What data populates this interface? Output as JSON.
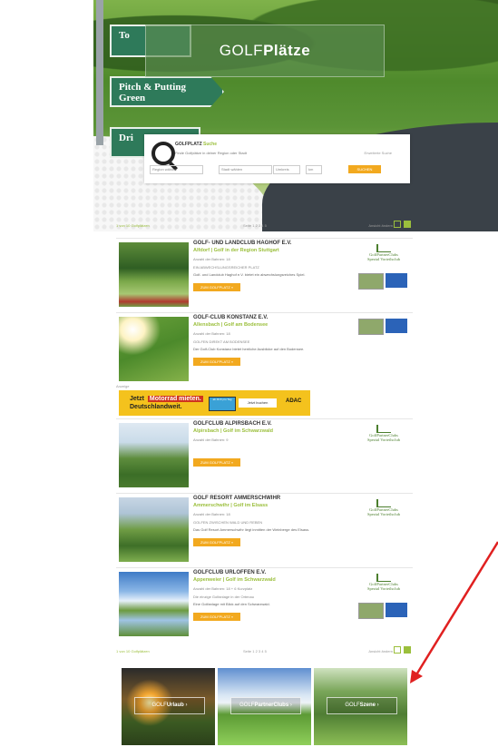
{
  "hero": {
    "logo_light": "GOLF",
    "logo_bold": "Plätze",
    "signs": [
      "To",
      "Pitch & Putting Green",
      "Dri"
    ]
  },
  "search": {
    "title_dark": "GOLFPLATZ",
    "title_accent": "Suche",
    "subtitle": "Finde Golfplätze in deiner Region oder Stadt",
    "right_hint": "Erweiterte Suche",
    "field1": "Region wählen",
    "field2": "Stadt wählen",
    "field3": "Umkreis",
    "field4": "km",
    "button": "SUCHEN"
  },
  "results_bar_top": {
    "left": "1 von 10 Golfplätzen",
    "middle": "Seite 1 2 3 4 5",
    "right": "Ansicht ändern"
  },
  "results": [
    {
      "name": "GOLF- UND LANDCLUB HAGHOF E.V.",
      "location": "Alfdorf | Golf in der Region Stuttgart",
      "line": "Anzahl der Bahnen: 18",
      "line2": "EIN ABWECHSLUNGSREICHER PLATZ",
      "desc": "Golf- und Landclub Haghof e.V. bietet ein abwechslungsreiches Spiel.",
      "cta": "ZUM GOLFPLATZ »",
      "partner": true
    },
    {
      "name": "GOLF-CLUB KONSTANZ E.V.",
      "location": "Allensbach | Golf am Bodensee",
      "line": "Anzahl der Bahnen: 18",
      "line2": "GOLFEN DIREKT AM BODENSEE",
      "desc": "Der Golf-Club Konstanz bietet herrliche Ausblicke auf den Bodensee.",
      "cta": "ZUM GOLFPLATZ »",
      "partner": false
    },
    {
      "name": "GOLFCLUB ALPIRSBACH E.V.",
      "location": "Alpirsbach | Golf im Schwarzwald",
      "line": "Anzahl der Bahnen: 9",
      "line2": "",
      "desc": "",
      "cta": "ZUM GOLFPLATZ »",
      "partner": true
    },
    {
      "name": "GOLF RESORT AMMERSCHWIHR",
      "location": "Ammerschwihr | Golf im Elsass",
      "line": "Anzahl der Bahnen: 18",
      "line2": "GOLFEN ZWISCHEN WALD UND REBEN",
      "desc": "Das Golf Resort Ammerschwihr liegt inmitten der Weinberge des Elsass.",
      "cta": "ZUM GOLFPLATZ »",
      "partner": true
    },
    {
      "name": "GOLFCLUB URLOFFEN E.V.",
      "location": "Appenweier | Golf im Schwarzwald",
      "line": "Anzahl der Bahnen: 18 + 6 Kurzplatz",
      "line2": "Die einzige Golfanlage in der Ortenau",
      "desc": "Eine Golfanlage mit Blick auf den Schwarzwald.",
      "cta": "ZUM GOLFPLATZ »",
      "partner": true
    }
  ],
  "ad": {
    "label": "Anzeige",
    "headline_highlight": "Motorrad mieten.",
    "headline_prefix": "Jetzt",
    "headline_line2": "Deutschlandweit.",
    "box": "ab 49 € pro Tag",
    "cta": "Jetzt buchen",
    "brand": "ADAC"
  },
  "partner_badge": {
    "title": "GolfPartnerClubs",
    "sub": "Spezial Vorteilsclub"
  },
  "results_bar_bottom": {
    "left": "1 von 10 Golfplätzen",
    "middle": "Seite 1 2 3 4 5",
    "right": "Ansicht ändern"
  },
  "tiles": [
    {
      "light": "GOLF",
      "bold": "Urlaub",
      "arrow": "›"
    },
    {
      "light": "GOLF",
      "bold": "PartnerClubs",
      "arrow": "›"
    },
    {
      "light": "GOLF",
      "bold": "Szene",
      "arrow": "›"
    }
  ],
  "colors": {
    "accent_green": "#9bbf3c",
    "cta_orange": "#f2a91f",
    "annotation_red": "#e02020"
  }
}
